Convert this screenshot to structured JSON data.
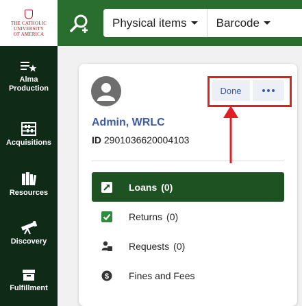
{
  "logo": {
    "line1": "THE CATHOLIC",
    "line2": "UNIVERSITY",
    "line3": "OF AMERICA"
  },
  "colors": {
    "nav_bg": "#0f2a17",
    "topbar_bg": "#2a6e2f",
    "active_item_bg": "#1f5223",
    "link": "#3c5aa0",
    "annotation": "#e02020"
  },
  "leftnav": {
    "items": [
      {
        "label": "Alma\nProduction",
        "icon": "alma-star-list-icon"
      },
      {
        "label": "Acquisitions",
        "icon": "abacus-icon"
      },
      {
        "label": "Resources",
        "icon": "books-icon"
      },
      {
        "label": "Discovery",
        "icon": "telescope-icon"
      },
      {
        "label": "Fulfillment",
        "icon": "archive-box-icon"
      }
    ]
  },
  "topbar": {
    "search_icon": "search-plus-icon",
    "scope_dropdown": "Physical items",
    "field_dropdown": "Barcode"
  },
  "card": {
    "user_name": "Admin, WRLC",
    "id_label": "ID",
    "id_value": "2901036620004103",
    "done_label": "Done",
    "more_icon": "ellipsis-icon",
    "menu": [
      {
        "label": "Loans",
        "count": "(0)",
        "icon": "arrow-out-icon",
        "active": true
      },
      {
        "label": "Returns",
        "count": "(0)",
        "icon": "check-square-icon",
        "active": false
      },
      {
        "label": "Requests",
        "count": "(0)",
        "icon": "person-request-icon",
        "active": false
      },
      {
        "label": "Fines and Fees",
        "count": "",
        "icon": "dollar-circle-icon",
        "active": false
      }
    ]
  }
}
